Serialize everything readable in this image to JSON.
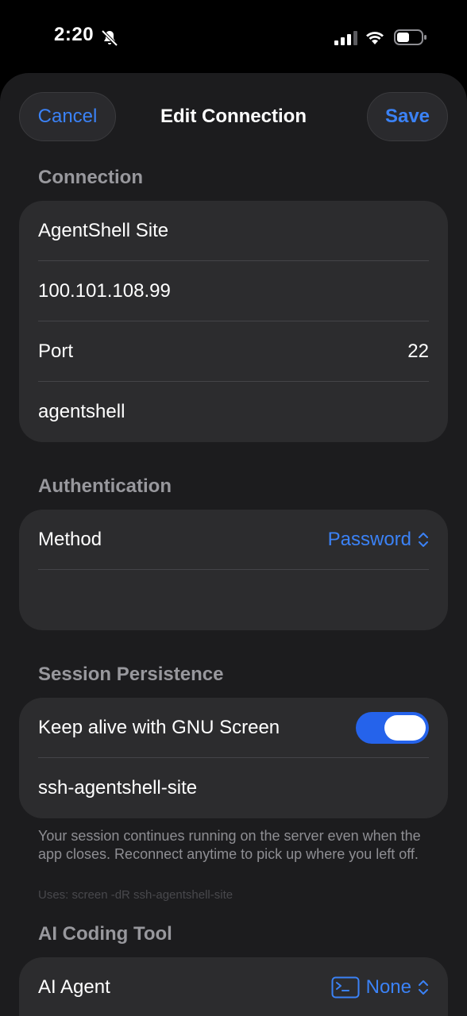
{
  "status_bar": {
    "time": "2:20"
  },
  "nav": {
    "cancel_label": "Cancel",
    "title": "Edit Connection",
    "save_label": "Save"
  },
  "connection": {
    "header": "Connection",
    "name": "AgentShell Site",
    "host": "100.101.108.99",
    "port_label": "Port",
    "port_value": "22",
    "username": "agentshell"
  },
  "authentication": {
    "header": "Authentication",
    "method_label": "Method",
    "method_value": "Password"
  },
  "session": {
    "header": "Session Persistence",
    "keep_alive_label": "Keep alive with GNU Screen",
    "keep_alive_on": true,
    "session_name": "ssh-agentshell-site",
    "footer": "Your session continues running on the server even when the app closes. Reconnect anytime to pick up where you left off.",
    "command_hint": "Uses: screen -dR ssh-agentshell-site"
  },
  "ai_tool": {
    "header": "AI Coding Tool",
    "agent_label": "AI Agent",
    "agent_value": "None"
  },
  "colors": {
    "accent": "#3b82f6",
    "toggle_on": "#2563eb",
    "card_bg": "#2c2c2e",
    "sheet_bg": "#1c1c1e"
  },
  "icons": {
    "bell": "bell-slash-icon",
    "signal": "cellular-signal-icon",
    "wifi": "wifi-icon",
    "battery": "battery-icon",
    "chevron": "chevron-up-down-icon",
    "terminal": "terminal-icon"
  }
}
